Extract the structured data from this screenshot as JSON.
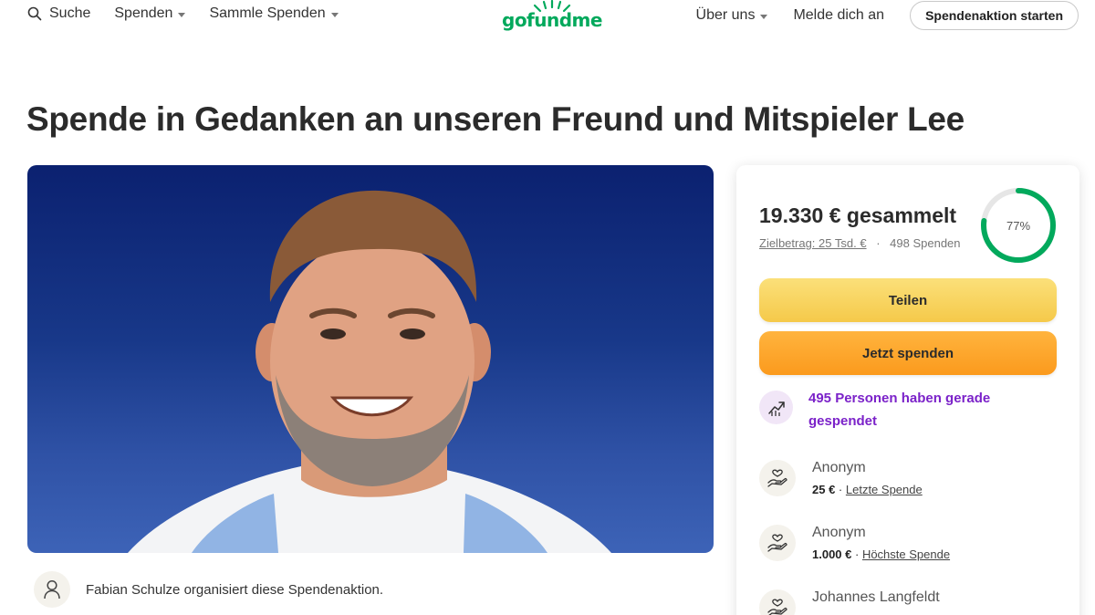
{
  "nav": {
    "search_label": "Suche",
    "donate_label": "Spenden",
    "collect_label": "Sammle Spenden",
    "about_label": "Über uns",
    "login_label": "Melde dich an",
    "start_label": "Spendenaktion starten"
  },
  "logo": {
    "text": "gofundme",
    "color": "#02a95c"
  },
  "page": {
    "title": "Spende in Gedanken an unseren Freund und Mitspieler Lee",
    "organizer_text": "Fabian Schulze organisiert diese Spendenaktion."
  },
  "campaign": {
    "raised_text": "19.330 € gesammelt",
    "goal_text": "Zielbetrag: 25 Tsd. €",
    "separator": "·",
    "donations_count_text": "498 Spenden",
    "progress_percent": 77,
    "progress_label": "77%",
    "progress_color": "#02a95c"
  },
  "buttons": {
    "share_label": "Teilen",
    "donate_now_label": "Jetzt spenden"
  },
  "activity": {
    "recent_text": "495 Personen haben gerade gespendet"
  },
  "donors": [
    {
      "name": "Anonym",
      "amount": "25 €",
      "sep": " · ",
      "tag": "Letzte Spende"
    },
    {
      "name": "Anonym",
      "amount": "1.000 €",
      "sep": " · ",
      "tag": "Höchste Spende"
    },
    {
      "name": "Johannes Langfeldt",
      "amount": "",
      "sep": "",
      "tag": ""
    }
  ],
  "icons": {
    "search": "search-icon",
    "trend": "trending-up-icon",
    "donor": "hand-heart-icon",
    "organizer": "user-icon"
  },
  "colors": {
    "accent_green": "#02a95c",
    "share_yellow": "#f5c94a",
    "donate_orange": "#fb9a1d",
    "trend_purple": "#7b22c9"
  }
}
